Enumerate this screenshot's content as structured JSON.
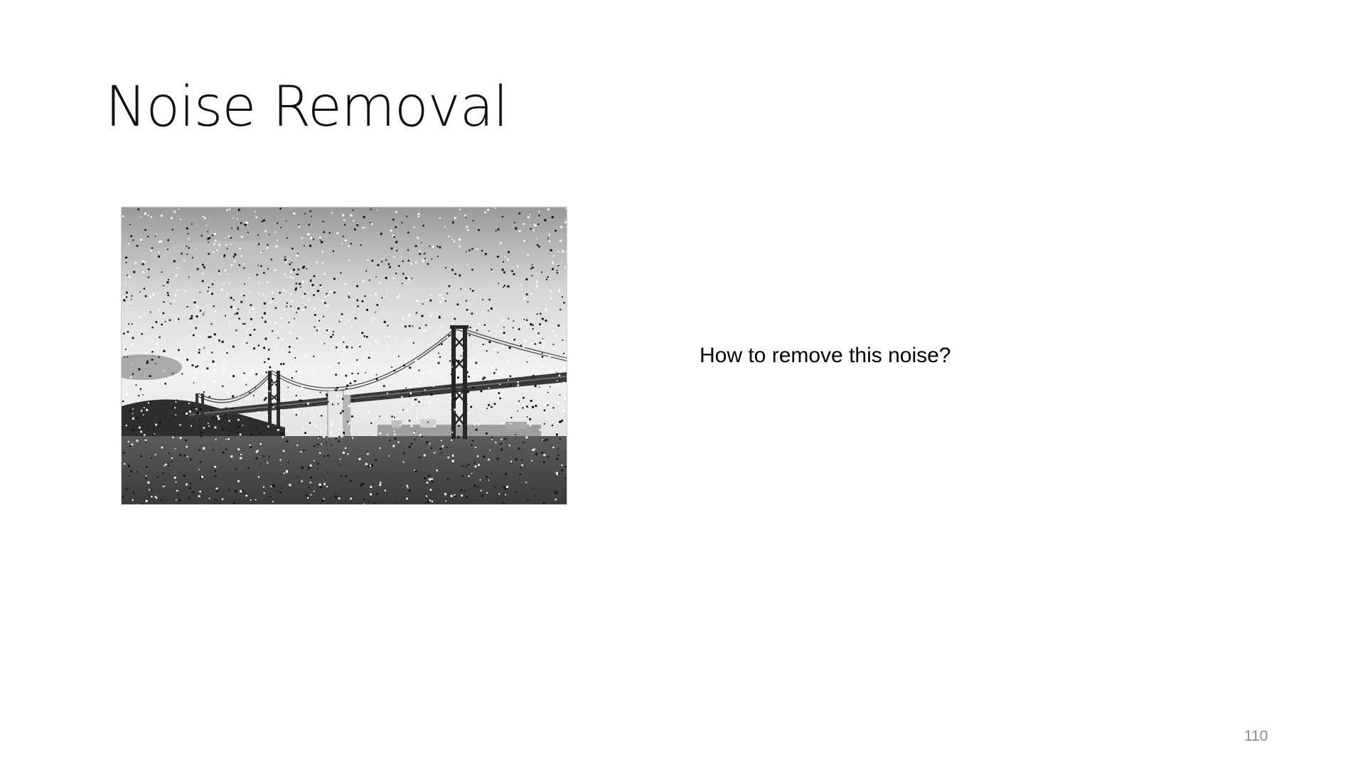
{
  "slide": {
    "title": "Noise Removal",
    "question": "How to remove this noise?",
    "page_number": "110"
  },
  "image": {
    "subject": "suspension-bridge-photo",
    "noise": "salt-and-pepper"
  }
}
